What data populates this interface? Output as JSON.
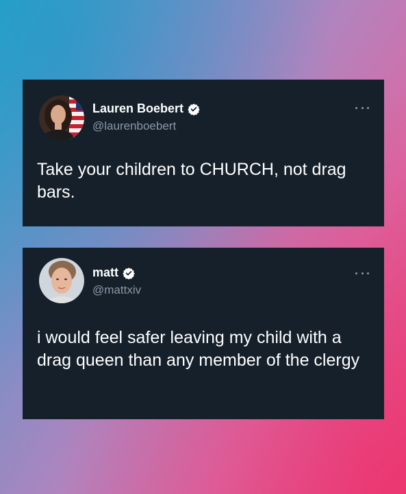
{
  "tweets": [
    {
      "display_name": "Lauren Boebert",
      "handle": "@laurenboebert",
      "text": "Take your children to CHURCH, not drag bars.",
      "verified": true,
      "avatar_icon": "woman-with-flag-avatar"
    },
    {
      "display_name": "matt",
      "handle": "@mattxiv",
      "text": "i would feel safer leaving my child with a drag queen than any member of the clergy",
      "verified": true,
      "avatar_icon": "young-man-avatar"
    }
  ],
  "colors": {
    "card_background": "#15202b",
    "handle_gray": "#8b98a5",
    "verified_badge": "#ffffff",
    "gradient_left": "#2fa6c9",
    "gradient_right": "#ea3f78"
  }
}
